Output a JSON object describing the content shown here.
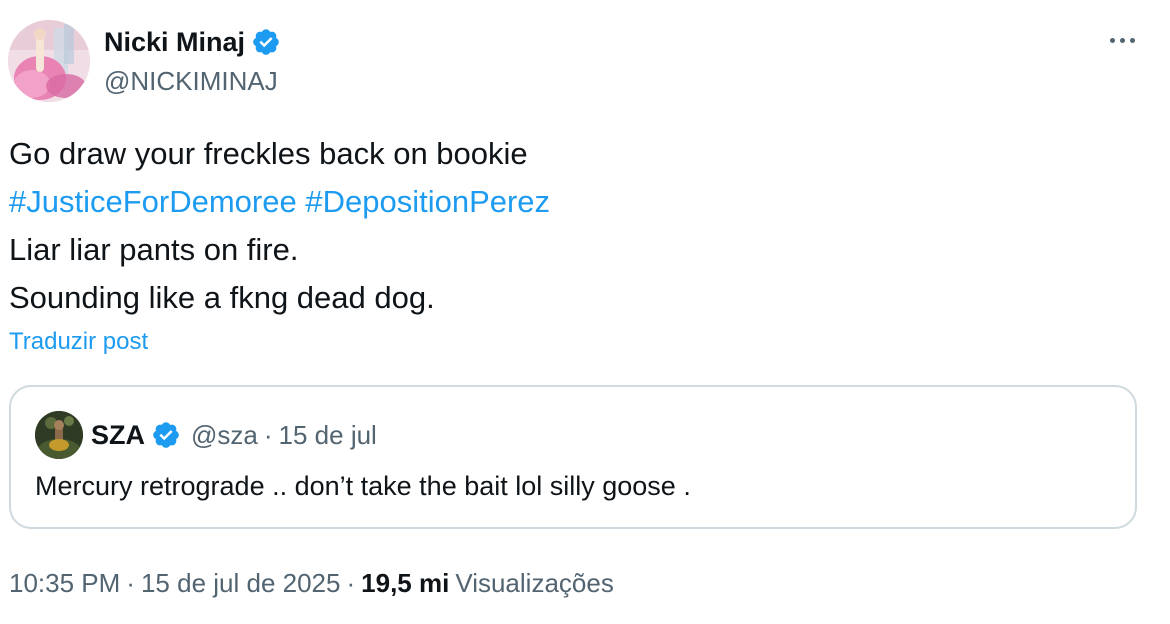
{
  "author": {
    "display_name": "Nicki Minaj",
    "handle": "@NICKIMINAJ",
    "verified": true,
    "avatar_icon": "profile-photo"
  },
  "more_icon": "more-options-icon",
  "post": {
    "lines": [
      "Go draw your freckles back on bookie",
      "Liar liar pants on fire.",
      "Sounding like a fkng dead dog."
    ],
    "hashtags": [
      "#JusticeForDemoree",
      "#DepositionPerez"
    ],
    "translate_label": "Traduzir post"
  },
  "quoted_post": {
    "display_name": "SZA",
    "handle": "@sza",
    "separator": "·",
    "date": "15 de jul",
    "verified": true,
    "text": "Mercury retrograde .. don’t take the bait lol silly goose ."
  },
  "meta": {
    "time": "10:35 PM",
    "separator": "·",
    "date": "15 de jul de 2025",
    "views_count": "19,5 mi",
    "views_label": "Visualizações"
  },
  "colors": {
    "text": "#0f1419",
    "secondary": "#536471",
    "link": "#1d9bf0",
    "border": "#cfd9de",
    "verified_badge": "#1d9bf0"
  }
}
